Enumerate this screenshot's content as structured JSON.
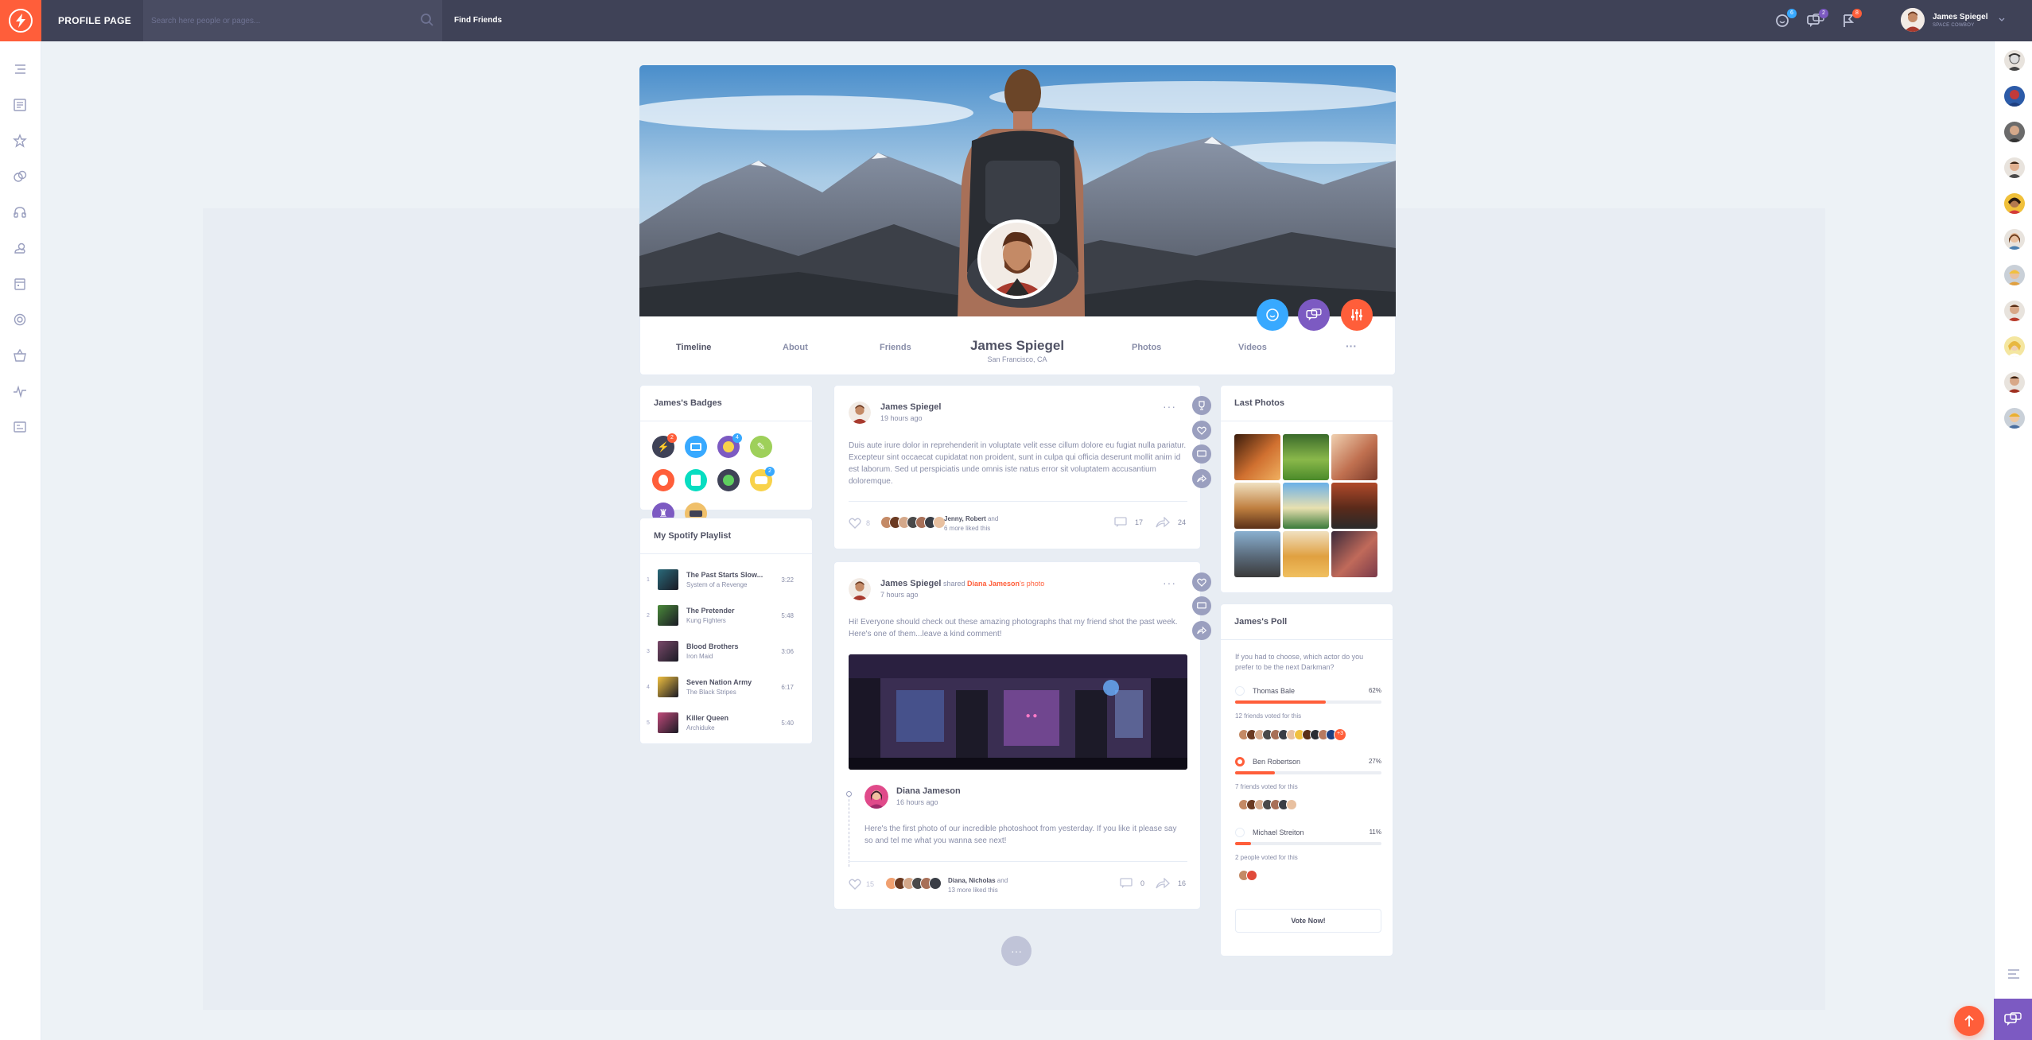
{
  "header": {
    "page_title": "PROFILE PAGE",
    "search_placeholder": "Search here people or pages...",
    "find_friends": "Find Friends",
    "friend_requests_count": "6",
    "messages_count": "2",
    "notifications_count": "8",
    "user_name": "James Spiegel",
    "user_status": "SPACE COWBOY"
  },
  "profile": {
    "name": "James Spiegel",
    "location": "San Francisco, CA",
    "nav": {
      "timeline": "Timeline",
      "about": "About",
      "friends": "Friends",
      "photos": "Photos",
      "videos": "Videos",
      "more": "···"
    }
  },
  "badges": {
    "title": "James's Badges",
    "count_1": "2",
    "count_3": "4",
    "count_8": "2"
  },
  "playlist": {
    "title": "My Spotify Playlist",
    "tracks": [
      {
        "num": "1",
        "title": "The Past Starts Slow...",
        "artist": "System of a Revenge",
        "time": "3:22"
      },
      {
        "num": "2",
        "title": "The Pretender",
        "artist": "Kung Fighters",
        "time": "5:48"
      },
      {
        "num": "3",
        "title": "Blood Brothers",
        "artist": "Iron Maid",
        "time": "3:06"
      },
      {
        "num": "4",
        "title": "Seven Nation Army",
        "artist": "The Black Stripes",
        "time": "6:17"
      },
      {
        "num": "5",
        "title": "Killer Queen",
        "artist": "Archiduke",
        "time": "5:40"
      }
    ]
  },
  "posts": [
    {
      "author": "James Spiegel",
      "time": "19 hours ago",
      "text": "Duis aute irure dolor in reprehenderit in voluptate velit esse cillum dolore eu fugiat nulla pariatur. Excepteur sint occaecat cupidatat non proident, sunt in culpa qui officia deserunt mollit anim id est laborum. Sed ut perspiciatis unde omnis iste natus error sit voluptatem accusantium doloremque.",
      "likes": "8",
      "liked_names": "Jenny, Robert",
      "liked_and": " and",
      "liked_more": "6 more liked this",
      "comments": "17",
      "shares": "24",
      "menu": "···"
    },
    {
      "author": "James Spiegel",
      "shared_word": " shared ",
      "shared_owner": "Diana Jameson",
      "shared_suffix": "'s photo",
      "time": "7 hours ago",
      "text": "Hi! Everyone should check out these amazing photographs that my friend shot the past week. Here's one of them...leave a kind comment!",
      "shared_author": "Diana Jameson",
      "shared_time": "16 hours ago",
      "shared_text": "Here's the first photo of our incredible photoshoot from yesterday. If you like it please say so and tel me what you wanna see next!",
      "likes": "15",
      "liked_names": "Diana, Nicholas",
      "liked_and": " and",
      "liked_more": "13 more liked this",
      "comments": "0",
      "shares": "16",
      "menu": "···"
    }
  ],
  "load_more": "···",
  "last_photos": {
    "title": "Last Photos"
  },
  "poll": {
    "title": "James's Poll",
    "question": "If you had to choose, which actor do you prefer to be the next Darkman?",
    "options": [
      {
        "name": "Thomas Bale",
        "pct": "62%",
        "value": 62,
        "votes": "12 friends voted for this",
        "more": "+3"
      },
      {
        "name": "Ben Robertson",
        "pct": "27%",
        "value": 27,
        "votes": "7 friends voted for this"
      },
      {
        "name": "Michael Streiton",
        "pct": "11%",
        "value": 11,
        "votes": "2 people voted for this"
      }
    ],
    "vote_button": "Vote Now!"
  },
  "colors": {
    "accent": "#ff5e3a",
    "purple": "#7c5ac2",
    "blue": "#38a9ff",
    "dark": "#3f4257"
  }
}
